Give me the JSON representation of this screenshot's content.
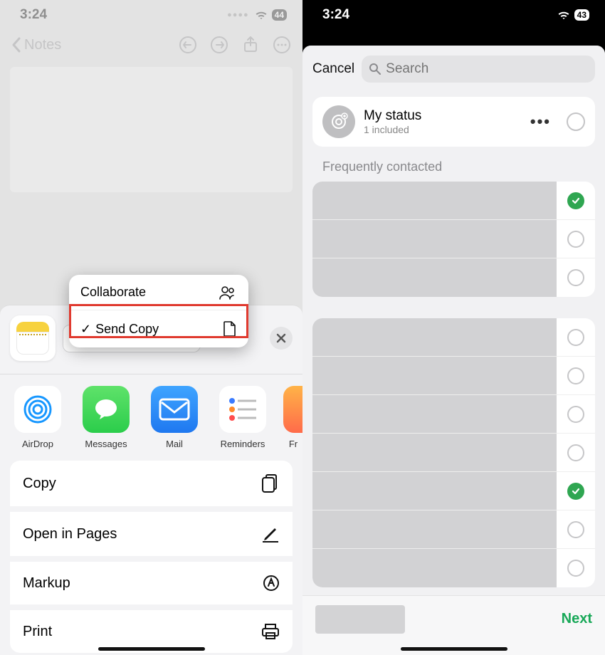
{
  "left": {
    "status": {
      "time": "3:24",
      "battery": "44"
    },
    "nav": {
      "back_label": "Notes"
    },
    "popup": {
      "collaborate_label": "Collaborate",
      "send_copy_label": "Send Copy"
    },
    "sheet": {
      "mode_label": "Send Copy",
      "share_targets": [
        {
          "label": "AirDrop"
        },
        {
          "label": "Messages"
        },
        {
          "label": "Mail"
        },
        {
          "label": "Reminders"
        },
        {
          "label": "Fr"
        }
      ],
      "actions": {
        "copy": "Copy",
        "open_in_pages": "Open in Pages",
        "markup": "Markup",
        "print": "Print"
      }
    }
  },
  "right": {
    "status": {
      "time": "3:24",
      "battery": "43"
    },
    "head": {
      "cancel": "Cancel",
      "search_placeholder": "Search"
    },
    "my_status": {
      "title": "My status",
      "subtitle": "1 included"
    },
    "section_title": "Frequently contacted",
    "contacts_group1": [
      {
        "selected": true
      },
      {
        "selected": false
      },
      {
        "selected": false
      }
    ],
    "contacts_group2": [
      {
        "selected": false
      },
      {
        "selected": false
      },
      {
        "selected": false
      },
      {
        "selected": false
      },
      {
        "selected": true
      },
      {
        "selected": false
      },
      {
        "selected": false
      }
    ],
    "footer": {
      "next": "Next"
    }
  }
}
